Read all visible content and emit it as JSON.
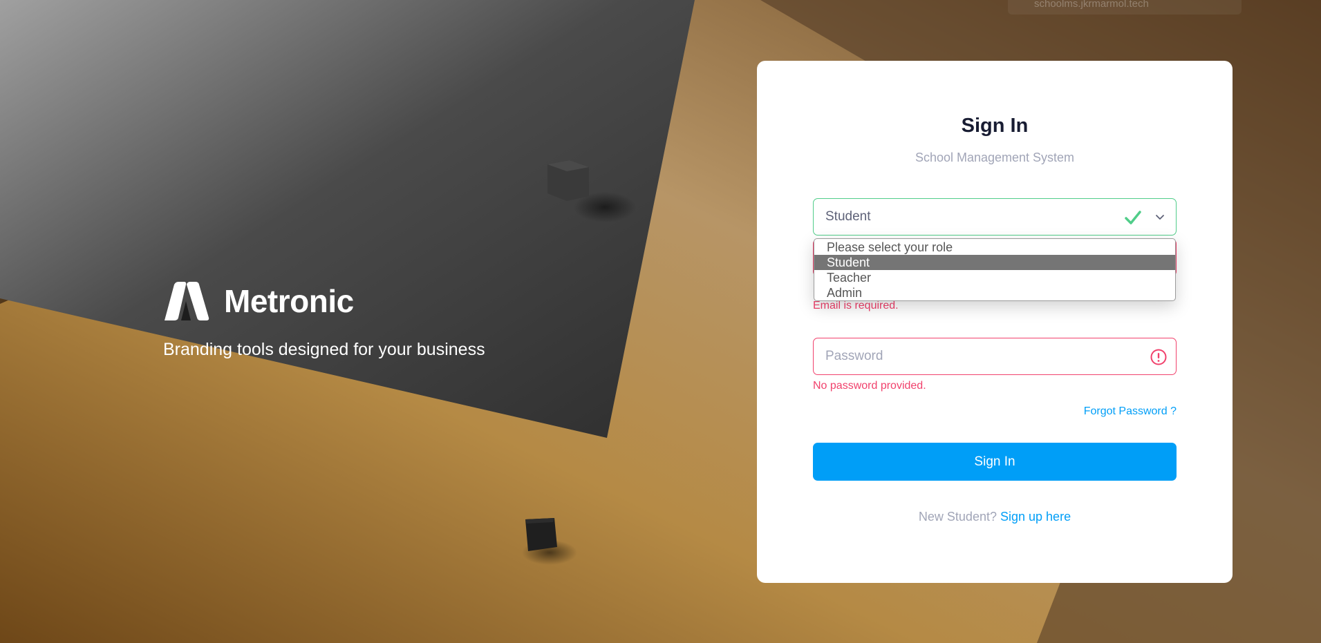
{
  "browser": {
    "url": "schoolms.jkrmarmol.tech"
  },
  "brand": {
    "name": "Metronic",
    "tagline": "Branding tools designed for your business"
  },
  "form": {
    "title": "Sign In",
    "subtitle": "School Management System",
    "role_select": {
      "value": "Student",
      "options": [
        "Please select your role",
        "Student",
        "Teacher",
        "Admin"
      ],
      "selected_index": 1
    },
    "email_error": "Email is required.",
    "password_placeholder": "Password",
    "password_error": "No password provided.",
    "forgot_password": "Forgot Password ?",
    "submit_label": "Sign In",
    "signup_prompt": "New Student?",
    "signup_link": "Sign up here"
  },
  "colors": {
    "primary": "#009ef7",
    "success": "#50cd89",
    "danger": "#f1416c",
    "title": "#181c32",
    "muted": "#a1a5b7"
  },
  "icons": [
    "logo-icon",
    "check-icon",
    "chevron-down-icon",
    "warning-icon"
  ]
}
